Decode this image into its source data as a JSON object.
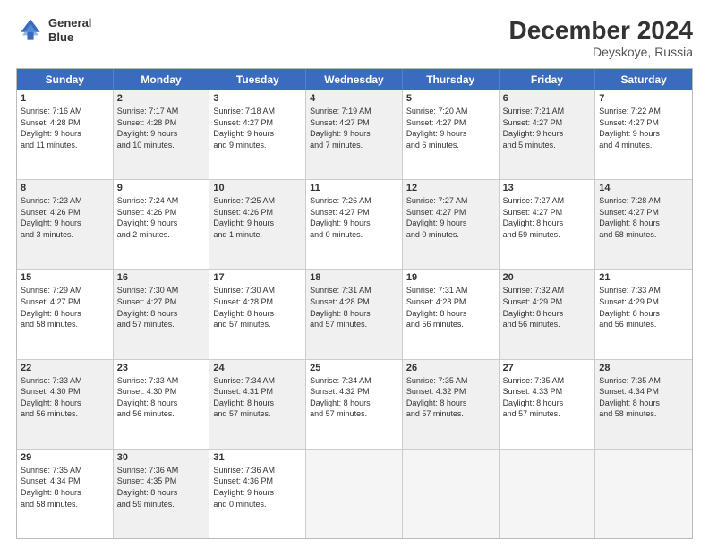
{
  "header": {
    "logo_line1": "General",
    "logo_line2": "Blue",
    "month": "December 2024",
    "location": "Deyskoye, Russia"
  },
  "weekdays": [
    "Sunday",
    "Monday",
    "Tuesday",
    "Wednesday",
    "Thursday",
    "Friday",
    "Saturday"
  ],
  "rows": [
    [
      {
        "day": "1",
        "info": "Sunrise: 7:16 AM\nSunset: 4:28 PM\nDaylight: 9 hours\nand 11 minutes.",
        "shaded": false
      },
      {
        "day": "2",
        "info": "Sunrise: 7:17 AM\nSunset: 4:28 PM\nDaylight: 9 hours\nand 10 minutes.",
        "shaded": true
      },
      {
        "day": "3",
        "info": "Sunrise: 7:18 AM\nSunset: 4:27 PM\nDaylight: 9 hours\nand 9 minutes.",
        "shaded": false
      },
      {
        "day": "4",
        "info": "Sunrise: 7:19 AM\nSunset: 4:27 PM\nDaylight: 9 hours\nand 7 minutes.",
        "shaded": true
      },
      {
        "day": "5",
        "info": "Sunrise: 7:20 AM\nSunset: 4:27 PM\nDaylight: 9 hours\nand 6 minutes.",
        "shaded": false
      },
      {
        "day": "6",
        "info": "Sunrise: 7:21 AM\nSunset: 4:27 PM\nDaylight: 9 hours\nand 5 minutes.",
        "shaded": true
      },
      {
        "day": "7",
        "info": "Sunrise: 7:22 AM\nSunset: 4:27 PM\nDaylight: 9 hours\nand 4 minutes.",
        "shaded": false
      }
    ],
    [
      {
        "day": "8",
        "info": "Sunrise: 7:23 AM\nSunset: 4:26 PM\nDaylight: 9 hours\nand 3 minutes.",
        "shaded": true
      },
      {
        "day": "9",
        "info": "Sunrise: 7:24 AM\nSunset: 4:26 PM\nDaylight: 9 hours\nand 2 minutes.",
        "shaded": false
      },
      {
        "day": "10",
        "info": "Sunrise: 7:25 AM\nSunset: 4:26 PM\nDaylight: 9 hours\nand 1 minute.",
        "shaded": true
      },
      {
        "day": "11",
        "info": "Sunrise: 7:26 AM\nSunset: 4:27 PM\nDaylight: 9 hours\nand 0 minutes.",
        "shaded": false
      },
      {
        "day": "12",
        "info": "Sunrise: 7:27 AM\nSunset: 4:27 PM\nDaylight: 9 hours\nand 0 minutes.",
        "shaded": true
      },
      {
        "day": "13",
        "info": "Sunrise: 7:27 AM\nSunset: 4:27 PM\nDaylight: 8 hours\nand 59 minutes.",
        "shaded": false
      },
      {
        "day": "14",
        "info": "Sunrise: 7:28 AM\nSunset: 4:27 PM\nDaylight: 8 hours\nand 58 minutes.",
        "shaded": true
      }
    ],
    [
      {
        "day": "15",
        "info": "Sunrise: 7:29 AM\nSunset: 4:27 PM\nDaylight: 8 hours\nand 58 minutes.",
        "shaded": false
      },
      {
        "day": "16",
        "info": "Sunrise: 7:30 AM\nSunset: 4:27 PM\nDaylight: 8 hours\nand 57 minutes.",
        "shaded": true
      },
      {
        "day": "17",
        "info": "Sunrise: 7:30 AM\nSunset: 4:28 PM\nDaylight: 8 hours\nand 57 minutes.",
        "shaded": false
      },
      {
        "day": "18",
        "info": "Sunrise: 7:31 AM\nSunset: 4:28 PM\nDaylight: 8 hours\nand 57 minutes.",
        "shaded": true
      },
      {
        "day": "19",
        "info": "Sunrise: 7:31 AM\nSunset: 4:28 PM\nDaylight: 8 hours\nand 56 minutes.",
        "shaded": false
      },
      {
        "day": "20",
        "info": "Sunrise: 7:32 AM\nSunset: 4:29 PM\nDaylight: 8 hours\nand 56 minutes.",
        "shaded": true
      },
      {
        "day": "21",
        "info": "Sunrise: 7:33 AM\nSunset: 4:29 PM\nDaylight: 8 hours\nand 56 minutes.",
        "shaded": false
      }
    ],
    [
      {
        "day": "22",
        "info": "Sunrise: 7:33 AM\nSunset: 4:30 PM\nDaylight: 8 hours\nand 56 minutes.",
        "shaded": true
      },
      {
        "day": "23",
        "info": "Sunrise: 7:33 AM\nSunset: 4:30 PM\nDaylight: 8 hours\nand 56 minutes.",
        "shaded": false
      },
      {
        "day": "24",
        "info": "Sunrise: 7:34 AM\nSunset: 4:31 PM\nDaylight: 8 hours\nand 57 minutes.",
        "shaded": true
      },
      {
        "day": "25",
        "info": "Sunrise: 7:34 AM\nSunset: 4:32 PM\nDaylight: 8 hours\nand 57 minutes.",
        "shaded": false
      },
      {
        "day": "26",
        "info": "Sunrise: 7:35 AM\nSunset: 4:32 PM\nDaylight: 8 hours\nand 57 minutes.",
        "shaded": true
      },
      {
        "day": "27",
        "info": "Sunrise: 7:35 AM\nSunset: 4:33 PM\nDaylight: 8 hours\nand 57 minutes.",
        "shaded": false
      },
      {
        "day": "28",
        "info": "Sunrise: 7:35 AM\nSunset: 4:34 PM\nDaylight: 8 hours\nand 58 minutes.",
        "shaded": true
      }
    ],
    [
      {
        "day": "29",
        "info": "Sunrise: 7:35 AM\nSunset: 4:34 PM\nDaylight: 8 hours\nand 58 minutes.",
        "shaded": false
      },
      {
        "day": "30",
        "info": "Sunrise: 7:36 AM\nSunset: 4:35 PM\nDaylight: 8 hours\nand 59 minutes.",
        "shaded": true
      },
      {
        "day": "31",
        "info": "Sunrise: 7:36 AM\nSunset: 4:36 PM\nDaylight: 9 hours\nand 0 minutes.",
        "shaded": false
      },
      {
        "day": "",
        "info": "",
        "shaded": true,
        "empty": true
      },
      {
        "day": "",
        "info": "",
        "shaded": false,
        "empty": true
      },
      {
        "day": "",
        "info": "",
        "shaded": true,
        "empty": true
      },
      {
        "day": "",
        "info": "",
        "shaded": false,
        "empty": true
      }
    ]
  ]
}
